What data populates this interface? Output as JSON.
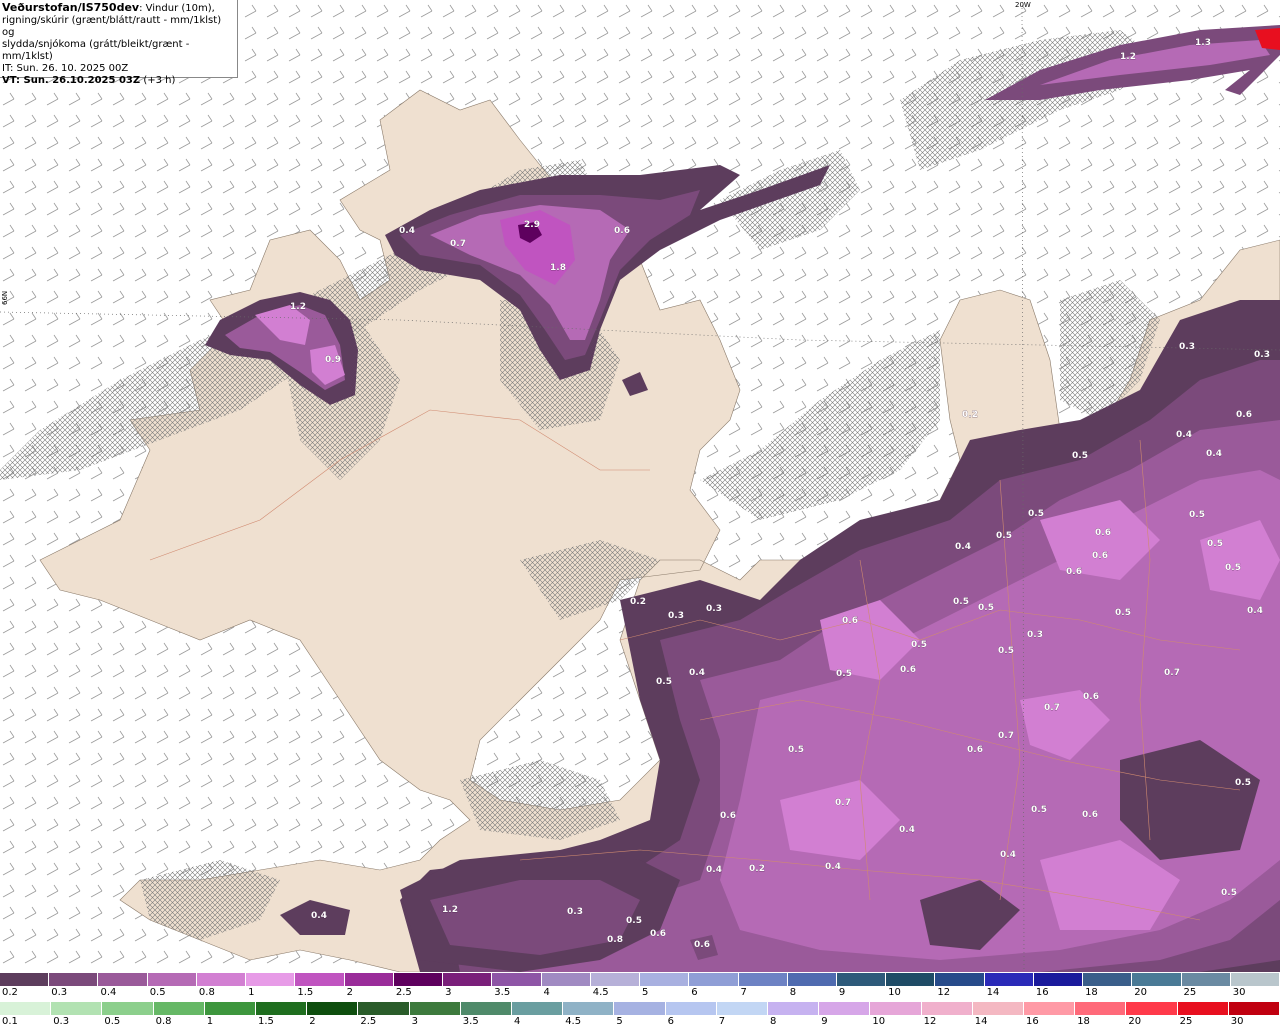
{
  "header": {
    "title": "Veðurstofan/IS750dev",
    "title_suffix": ": Vindur (10m),",
    "line2": "rigning/skúrir (grænt/blátt/rautt - mm/1klst) og",
    "line3": "slydda/snjókoma (grátt/bleikt/grænt - mm/1klst)",
    "it": "IT: Sun. 26. 10. 2025 00Z",
    "vt": "VT: Sun. 26.10.2025 03Z",
    "vt_suffix": "(+3 h)"
  },
  "graticule": {
    "lon_label": "20W",
    "lat_label": "66N"
  },
  "map_values": [
    "1.3",
    "1.2",
    "2.9",
    "1.8",
    "0.4",
    "0.7",
    "0.6",
    "1.2",
    "0.9",
    "0.2",
    "0.3",
    "0.6",
    "0.3",
    "0.4",
    "0.5",
    "0.4",
    "0.5",
    "0.6",
    "0.5",
    "0.5",
    "0.6",
    "0.5",
    "0.6",
    "0.5",
    "0.2",
    "0.3",
    "0.3",
    "0.5",
    "0.5",
    "0.4",
    "0.6",
    "0.7",
    "0.4",
    "0.4",
    "0.5",
    "0.5",
    "0.5",
    "0.6",
    "0.5",
    "0.6",
    "0.7",
    "0.5",
    "0.5",
    "0.6",
    "0.7",
    "0.3",
    "0.5",
    "0.7",
    "0.5",
    "0.6",
    "0.6",
    "0.4",
    "0.4",
    "0.4",
    "0.2",
    "0.4",
    "1.2",
    "0.3",
    "0.5",
    "0.6",
    "0.8",
    "0.4",
    "0.6",
    "0.5"
  ],
  "legend_top": {
    "labels": [
      "0.2",
      "0.3",
      "0.4",
      "0.5",
      "0.8",
      "1",
      "1.5",
      "2",
      "2.5",
      "3",
      "3.5",
      "4",
      "4.5",
      "5",
      "6",
      "7",
      "8",
      "9",
      "10",
      "12",
      "14",
      "16",
      "18",
      "20",
      "25",
      "30"
    ],
    "colors": [
      "#5d3d5d",
      "#7b4a7b",
      "#9a5a9a",
      "#b56ab5",
      "#d27fd2",
      "#e79be7",
      "#c054c0",
      "#9a2c9a",
      "#5e005e",
      "#7a1f7a",
      "#8e55a6",
      "#a08ac2",
      "#b6b0d8",
      "#a8b0e0",
      "#8f9ed6",
      "#6d82c4",
      "#4f6bb0",
      "#2e5a7a",
      "#1f4c66",
      "#274b8a",
      "#2a2ab8",
      "#1a1a9c",
      "#3a5e8a",
      "#4a7a96",
      "#6a8aa2",
      "#b9c6cc"
    ]
  },
  "legend_bottom": {
    "labels": [
      "0.1",
      "0.3",
      "0.5",
      "0.8",
      "1",
      "1.5",
      "2",
      "2.5",
      "3",
      "3.5",
      "4",
      "4.5",
      "5",
      "6",
      "7",
      "8",
      "9",
      "10",
      "12",
      "14",
      "16",
      "18",
      "20",
      "25",
      "30"
    ],
    "colors": [
      "#d8f2d8",
      "#b2e2b2",
      "#8ccf8c",
      "#66b866",
      "#3d963d",
      "#1f6e1f",
      "#0e4e0e",
      "#2a5c2a",
      "#3d7a3d",
      "#4f8a6a",
      "#6a9ea0",
      "#8fb2c6",
      "#a6b2e2",
      "#b6c6f0",
      "#c2d6f4",
      "#c6b2f0",
      "#d6a6e8",
      "#e6a6d8",
      "#f0b0cc",
      "#f4b8c2",
      "#ff9aa6",
      "#ff6a7a",
      "#ff3a4a",
      "#e80f1f",
      "#c00010"
    ]
  }
}
